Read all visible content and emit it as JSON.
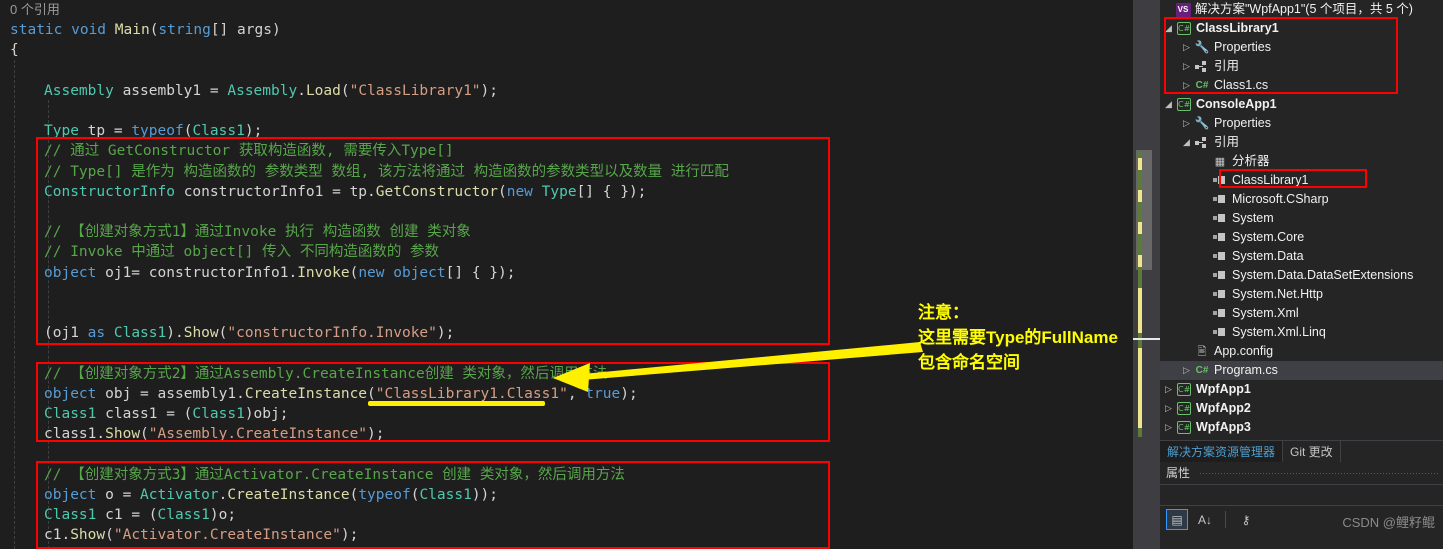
{
  "editor": {
    "reference_hint": "0 个引用",
    "lines": [
      {
        "indent": 0,
        "tokens": [
          [
            "ref",
            "0 个引用"
          ]
        ]
      },
      {
        "indent": 0,
        "tokens": [
          [
            "kw",
            "static "
          ],
          [
            "kw",
            "void "
          ],
          [
            "mth",
            "Main"
          ],
          [
            "punc",
            "("
          ],
          [
            "kw",
            "string"
          ],
          [
            "punc",
            "[] "
          ],
          [
            "id",
            "args"
          ],
          [
            "punc",
            ")"
          ]
        ]
      },
      {
        "indent": 0,
        "tokens": [
          [
            "punc",
            "{"
          ]
        ]
      },
      {
        "indent": 2,
        "tokens": []
      },
      {
        "indent": 2,
        "tokens": [
          [
            "typ",
            "Assembly "
          ],
          [
            "id",
            "assembly1 "
          ],
          [
            "punc",
            "= "
          ],
          [
            "typ",
            "Assembly"
          ],
          [
            "punc",
            "."
          ],
          [
            "mth",
            "Load"
          ],
          [
            "punc",
            "("
          ],
          [
            "str",
            "\"ClassLibrary1\""
          ],
          [
            "punc",
            ");"
          ]
        ]
      },
      {
        "indent": 2,
        "tokens": []
      },
      {
        "indent": 2,
        "tokens": [
          [
            "typ",
            "Type "
          ],
          [
            "id",
            "tp "
          ],
          [
            "punc",
            "= "
          ],
          [
            "kw",
            "typeof"
          ],
          [
            "punc",
            "("
          ],
          [
            "typ",
            "Class1"
          ],
          [
            "punc",
            ");"
          ]
        ]
      },
      {
        "indent": 2,
        "tokens": [
          [
            "cmt",
            "// 通过 GetConstructor 获取构造函数, 需要传入Type[]"
          ]
        ]
      },
      {
        "indent": 2,
        "tokens": [
          [
            "cmt",
            "// Type[] 是作为 构造函数的 参数类型 数组, 该方法将通过 构造函数的参数类型以及数量 进行匹配"
          ]
        ]
      },
      {
        "indent": 2,
        "tokens": [
          [
            "typ",
            "ConstructorInfo "
          ],
          [
            "id",
            "constructorInfo1 "
          ],
          [
            "punc",
            "= "
          ],
          [
            "id",
            "tp"
          ],
          [
            "punc",
            "."
          ],
          [
            "mth",
            "GetConstructor"
          ],
          [
            "punc",
            "("
          ],
          [
            "kw",
            "new "
          ],
          [
            "typ",
            "Type"
          ],
          [
            "punc",
            "[] { });"
          ]
        ]
      },
      {
        "indent": 2,
        "tokens": []
      },
      {
        "indent": 2,
        "tokens": [
          [
            "cmt",
            "// 【创建对象方式1】通过Invoke 执行 构造函数 创建 类对象"
          ]
        ]
      },
      {
        "indent": 2,
        "tokens": [
          [
            "cmt",
            "// Invoke 中通过 object[] 传入 不同构造函数的 参数"
          ]
        ]
      },
      {
        "indent": 2,
        "tokens": [
          [
            "kw",
            "object "
          ],
          [
            "id",
            "oj1= "
          ],
          [
            "id",
            "constructorInfo1"
          ],
          [
            "punc",
            "."
          ],
          [
            "mth",
            "Invoke"
          ],
          [
            "punc",
            "("
          ],
          [
            "kw",
            "new "
          ],
          [
            "kw",
            "object"
          ],
          [
            "punc",
            "[] { });"
          ]
        ]
      },
      {
        "indent": 2,
        "tokens": []
      },
      {
        "indent": 2,
        "tokens": []
      },
      {
        "indent": 2,
        "tokens": [
          [
            "punc",
            "("
          ],
          [
            "id",
            "oj1 "
          ],
          [
            "kw",
            "as "
          ],
          [
            "typ",
            "Class1"
          ],
          [
            "punc",
            ")."
          ],
          [
            "mth",
            "Show"
          ],
          [
            "punc",
            "("
          ],
          [
            "str",
            "\"constructorInfo.Invoke\""
          ],
          [
            "punc",
            ");"
          ]
        ]
      },
      {
        "indent": 2,
        "tokens": []
      },
      {
        "indent": 2,
        "tokens": [
          [
            "cmt",
            "// 【创建对象方式2】通过Assembly.CreateInstance创建 类对象，然后调用方法"
          ]
        ]
      },
      {
        "indent": 2,
        "tokens": [
          [
            "kw",
            "object "
          ],
          [
            "id",
            "obj "
          ],
          [
            "punc",
            "= "
          ],
          [
            "id",
            "assembly1"
          ],
          [
            "punc",
            "."
          ],
          [
            "mth",
            "CreateInstance"
          ],
          [
            "punc",
            "("
          ],
          [
            "str",
            "\"ClassLibrary1.Class1\""
          ],
          [
            "punc",
            ", "
          ],
          [
            "kw",
            "true"
          ],
          [
            "punc",
            ");"
          ]
        ]
      },
      {
        "indent": 2,
        "tokens": [
          [
            "typ",
            "Class1 "
          ],
          [
            "id",
            "class1 "
          ],
          [
            "punc",
            "= ("
          ],
          [
            "typ",
            "Class1"
          ],
          [
            "punc",
            ")"
          ],
          [
            "id",
            "obj"
          ],
          [
            "punc",
            ";"
          ]
        ]
      },
      {
        "indent": 2,
        "tokens": [
          [
            "id",
            "class1"
          ],
          [
            "punc",
            "."
          ],
          [
            "mth",
            "Show"
          ],
          [
            "punc",
            "("
          ],
          [
            "str",
            "\"Assembly.CreateInstance\""
          ],
          [
            "punc",
            ");"
          ]
        ]
      },
      {
        "indent": 2,
        "tokens": []
      },
      {
        "indent": 2,
        "tokens": [
          [
            "cmt",
            "// 【创建对象方式3】通过Activator.CreateInstance 创建 类对象，然后调用方法"
          ]
        ]
      },
      {
        "indent": 2,
        "tokens": [
          [
            "kw",
            "object "
          ],
          [
            "id",
            "o "
          ],
          [
            "punc",
            "= "
          ],
          [
            "typ",
            "Activator"
          ],
          [
            "punc",
            "."
          ],
          [
            "mth",
            "CreateInstance"
          ],
          [
            "punc",
            "("
          ],
          [
            "kw",
            "typeof"
          ],
          [
            "punc",
            "("
          ],
          [
            "typ",
            "Class1"
          ],
          [
            "punc",
            "));"
          ]
        ]
      },
      {
        "indent": 2,
        "tokens": [
          [
            "typ",
            "Class1 "
          ],
          [
            "id",
            "c1 "
          ],
          [
            "punc",
            "= ("
          ],
          [
            "typ",
            "Class1"
          ],
          [
            "punc",
            ")"
          ],
          [
            "id",
            "o"
          ],
          [
            "punc",
            ";"
          ]
        ]
      },
      {
        "indent": 2,
        "tokens": [
          [
            "id",
            "c1"
          ],
          [
            "punc",
            "."
          ],
          [
            "mth",
            "Show"
          ],
          [
            "punc",
            "("
          ],
          [
            "str",
            "\"Activator.CreateInstance\""
          ],
          [
            "punc",
            ");"
          ]
        ]
      }
    ]
  },
  "annotation": {
    "note_lines": [
      "注意：",
      "这里需要Type的FullName",
      "包含命名空间"
    ],
    "note_color": "#FFFF00",
    "box_color": "#FF0000",
    "arrow_color": "#FFF000",
    "underline_target": "ClassLibrary1.Class1"
  },
  "solution": {
    "header": "解决方案\"WpfApp1\"(5 个项目，共 5 个)",
    "tree": [
      {
        "depth": 0,
        "twisty": "collapse",
        "icon": "csproj-icon",
        "label": "ClassLibrary1",
        "bold": true
      },
      {
        "depth": 1,
        "twisty": "expand",
        "icon": "wrench-icon",
        "label": "Properties",
        "bold": false
      },
      {
        "depth": 1,
        "twisty": "expand",
        "icon": "reference-icon",
        "label": "引用",
        "bold": false
      },
      {
        "depth": 1,
        "twisty": "expand",
        "icon": "cs-file-icon",
        "label": "Class1.cs",
        "bold": false
      },
      {
        "depth": 0,
        "twisty": "collapse",
        "icon": "csproj-icon",
        "label": "ConsoleApp1",
        "bold": true
      },
      {
        "depth": 1,
        "twisty": "expand",
        "icon": "wrench-icon",
        "label": "Properties",
        "bold": false
      },
      {
        "depth": 1,
        "twisty": "collapse",
        "icon": "reference-icon",
        "label": "引用",
        "bold": false
      },
      {
        "depth": 2,
        "twisty": "none",
        "icon": "analyzer-icon",
        "label": "分析器",
        "bold": false
      },
      {
        "depth": 2,
        "twisty": "none",
        "icon": "dll-icon",
        "label": "ClassLibrary1",
        "bold": false
      },
      {
        "depth": 2,
        "twisty": "none",
        "icon": "dll-icon",
        "label": "Microsoft.CSharp",
        "bold": false
      },
      {
        "depth": 2,
        "twisty": "none",
        "icon": "dll-icon",
        "label": "System",
        "bold": false
      },
      {
        "depth": 2,
        "twisty": "none",
        "icon": "dll-icon",
        "label": "System.Core",
        "bold": false
      },
      {
        "depth": 2,
        "twisty": "none",
        "icon": "dll-icon",
        "label": "System.Data",
        "bold": false
      },
      {
        "depth": 2,
        "twisty": "none",
        "icon": "dll-icon",
        "label": "System.Data.DataSetExtensions",
        "bold": false
      },
      {
        "depth": 2,
        "twisty": "none",
        "icon": "dll-icon",
        "label": "System.Net.Http",
        "bold": false
      },
      {
        "depth": 2,
        "twisty": "none",
        "icon": "dll-icon",
        "label": "System.Xml",
        "bold": false
      },
      {
        "depth": 2,
        "twisty": "none",
        "icon": "dll-icon",
        "label": "System.Xml.Linq",
        "bold": false
      },
      {
        "depth": 1,
        "twisty": "none",
        "icon": "config-icon",
        "label": "App.config",
        "bold": false
      },
      {
        "depth": 1,
        "twisty": "expand",
        "icon": "cs-file-icon",
        "label": "Program.cs",
        "bold": false,
        "selected": true
      },
      {
        "depth": 0,
        "twisty": "expand",
        "icon": "csproj-icon",
        "label": "WpfApp1",
        "bold": true
      },
      {
        "depth": 0,
        "twisty": "expand",
        "icon": "csproj-icon",
        "label": "WpfApp2",
        "bold": true
      },
      {
        "depth": 0,
        "twisty": "expand",
        "icon": "csproj-icon",
        "label": "WpfApp3",
        "bold": true
      }
    ],
    "highlight_boxes": [
      "ClassLibrary1-project-group",
      "ClassLibrary1-reference"
    ]
  },
  "tabs": [
    {
      "label": "解决方案资源管理器",
      "active": true
    },
    {
      "label": "Git 更改",
      "active": false
    }
  ],
  "properties": {
    "title": "属性",
    "toolbar": [
      {
        "name": "categorized-button",
        "glyph": "▤",
        "selected": true
      },
      {
        "name": "alphabetical-sort-button",
        "glyph": "A↓",
        "selected": false
      },
      {
        "name": "property-pages-button",
        "glyph": "⚷",
        "selected": false
      }
    ]
  },
  "watermark": "CSDN @鲤籽鲲"
}
